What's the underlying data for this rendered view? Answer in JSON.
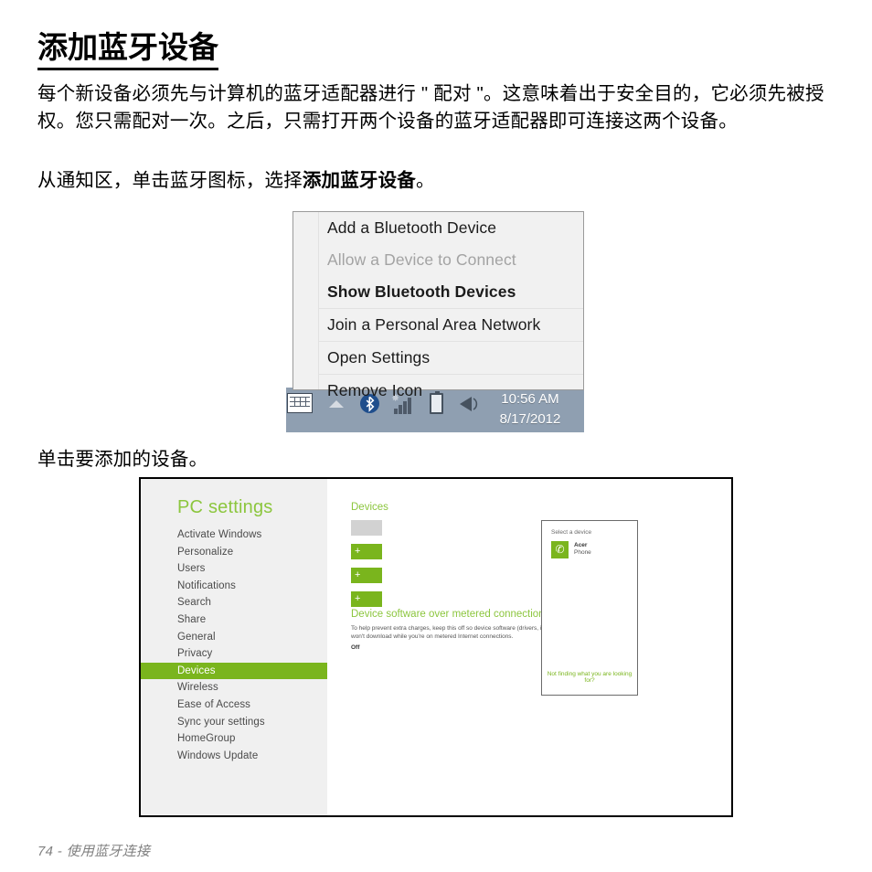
{
  "document": {
    "heading": "添加蓝牙设备",
    "paragraph": "每个新设备必须先与计算机的蓝牙适配器进行 \" 配对 \"。这意味着出于安全目的，它必须先被授权。您只需配对一次。之后，只需打开两个设备的蓝牙适配器即可连接这两个设备。",
    "step1_prefix": "从通知区，单击蓝牙图标，选择",
    "step1_bold": "添加蓝牙设备",
    "step1_suffix": "。",
    "step2": "单击要添加的设备。",
    "footer": "74 - 使用蓝牙连接"
  },
  "context_menu": {
    "items": [
      {
        "label": "Add a Bluetooth Device",
        "state": "normal",
        "separator_above": false
      },
      {
        "label": "Allow a Device to Connect",
        "state": "disabled",
        "separator_above": false
      },
      {
        "label": "Show Bluetooth Devices",
        "state": "bold",
        "separator_above": false
      },
      {
        "label": "Join a Personal Area Network",
        "state": "normal",
        "separator_above": true
      },
      {
        "label": "Open Settings",
        "state": "normal",
        "separator_above": true
      },
      {
        "label": "Remove Icon",
        "state": "normal",
        "separator_above": true
      }
    ]
  },
  "taskbar": {
    "icons": [
      {
        "name": "keyboard-icon"
      },
      {
        "name": "show-hidden-icons-chevron"
      },
      {
        "name": "bluetooth-icon",
        "glyph": "ᛦ"
      },
      {
        "name": "network-signal-icon"
      },
      {
        "name": "battery-icon"
      },
      {
        "name": "volume-icon"
      }
    ],
    "clock_time": "10:56 AM",
    "clock_date": "8/17/2012"
  },
  "pc_settings": {
    "title": "PC settings",
    "nav_items": [
      "Activate Windows",
      "Personalize",
      "Users",
      "Notifications",
      "Search",
      "Share",
      "General",
      "Privacy",
      "Devices",
      "Wireless",
      "Ease of Access",
      "Sync your settings",
      "HomeGroup",
      "Windows Update"
    ],
    "active_nav": "Devices",
    "main": {
      "heading": "Devices",
      "add_device_tile_label": "+",
      "metered_heading": "Device software over metered connections",
      "metered_body": "To help prevent extra charges, keep this off so device software (drivers, info, and apps) for new devices won't download while you're on metered Internet connections.",
      "metered_toggle": "Off"
    },
    "dialog": {
      "title": "Select a device",
      "device_name": "Acer",
      "device_kind": "Phone",
      "footer_link": "Not finding what you are looking for?"
    }
  },
  "colors": {
    "accent_green": "#7ab51d",
    "heading_green": "#8cc63e",
    "taskbar_blue": "#8f9fb1",
    "bluetooth_blue": "#1f4e8c",
    "menu_bg": "#f1f1f1"
  }
}
